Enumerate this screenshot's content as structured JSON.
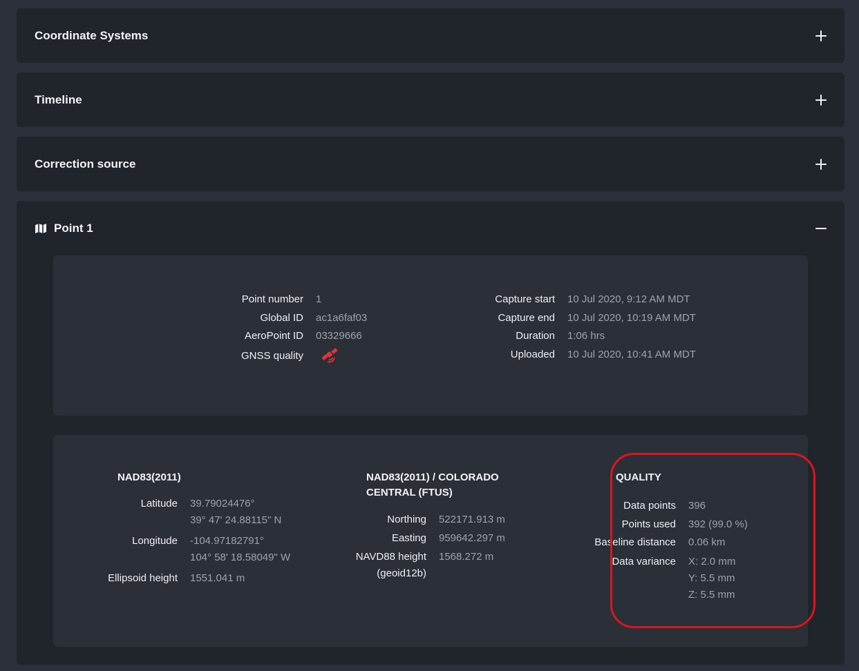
{
  "panels": {
    "coordinate_systems": {
      "title": "Coordinate Systems"
    },
    "timeline": {
      "title": "Timeline"
    },
    "correction_source": {
      "title": "Correction source"
    },
    "point": {
      "title": "Point 1"
    }
  },
  "summary": {
    "left": [
      {
        "label": "Point number",
        "value": "1"
      },
      {
        "label": "Global ID",
        "value": "ac1a6faf03"
      },
      {
        "label": "AeroPoint ID",
        "value": "03329666"
      },
      {
        "label": "GNSS quality",
        "icon": "satellite-icon"
      }
    ],
    "right": [
      {
        "label": "Capture start",
        "value": "10 Jul 2020, 9:12 AM MDT"
      },
      {
        "label": "Capture end",
        "value": "10 Jul 2020, 10:19 AM MDT"
      },
      {
        "label": "Duration",
        "value": "1:06 hrs"
      },
      {
        "label": "Uploaded",
        "value": "10 Jul 2020, 10:41 AM MDT"
      }
    ]
  },
  "nad83": {
    "title": "NAD83(2011)",
    "latitude_label": "Latitude",
    "latitude_dec": "39.79024476°",
    "latitude_dms": "39° 47' 24.88115\" N",
    "longitude_label": "Longitude",
    "longitude_dec": "-104.97182791°",
    "longitude_dms": "104° 58' 18.58049\" W",
    "ellipsoid_label": "Ellipsoid height",
    "ellipsoid_value": "1551.041 m"
  },
  "colorado": {
    "title_line1": "NAD83(2011) / COLORADO",
    "title_line2": "CENTRAL (FTUS)",
    "northing_label": "Northing",
    "northing_value": "522171.913 m",
    "easting_label": "Easting",
    "easting_value": "959642.297 m",
    "navd_label_line1": "NAVD88 height",
    "navd_label_line2": "(geoid12b)",
    "navd_value": "1568.272 m"
  },
  "quality": {
    "title": "QUALITY",
    "data_points_label": "Data points",
    "data_points_value": "396",
    "points_used_label": "Points used",
    "points_used_value": "392 (99.0 %)",
    "baseline_label": "Baseline distance",
    "baseline_value": "0.06 km",
    "variance_label": "Data variance",
    "variance_x": "X: 2.0 mm",
    "variance_y": "Y: 5.5 mm",
    "variance_z": "Z: 5.5 mm"
  },
  "colors": {
    "background": "#2b303a",
    "panel": "#20242b",
    "card": "#2a2f38",
    "highlight": "#e0141e",
    "gnss_icon": "#e0343c"
  }
}
